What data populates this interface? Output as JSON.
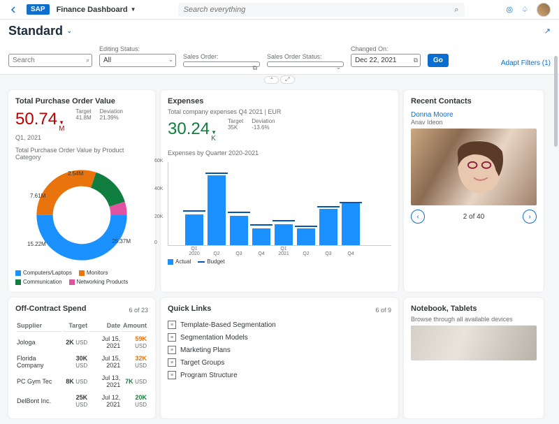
{
  "topbar": {
    "app_title": "Finance Dashboard",
    "search_placeholder": "Search everything"
  },
  "header": {
    "page_title": "Standard"
  },
  "filters": {
    "search_placeholder": "Search",
    "editing_label": "Editing Status:",
    "editing_value": "All",
    "sales_order_label": "Sales Order:",
    "sales_status_label": "Sales Order Status:",
    "changed_label": "Changed On:",
    "changed_value": "Dec 22, 2021",
    "go": "Go",
    "adapt": "Adapt Filters (1)"
  },
  "purchase_card": {
    "title": "Total Purchase Order Value",
    "value": "50.74",
    "unit": "M",
    "period": "Q1, 2021",
    "target_label": "Target",
    "target": "41.8M",
    "deviation_label": "Deviation",
    "deviation": "21.39%",
    "chart_title": "Total Purchase Order Value by Product Category",
    "legend": [
      "Computers/Laptops",
      "Monitors",
      "Communication",
      "Networking Products"
    ]
  },
  "expenses_card": {
    "title": "Expenses",
    "subtitle": "Total company expenses Q4 2021 | EUR",
    "value": "30.24",
    "unit": "K",
    "target_label": "Target",
    "target": "35K",
    "deviation_label": "Deviation",
    "deviation": "-13.6%",
    "chart_title": "Expenses by Quarter 2020-2021",
    "legend_actual": "Actual",
    "legend_budget": "Budget"
  },
  "contacts": {
    "title": "Recent Contacts",
    "name1": "Donna Moore",
    "name2": "Anav Ideon",
    "pager": "2 of 40"
  },
  "spend": {
    "title": "Off-Contract Spend",
    "pager": "6 of 23",
    "cols": {
      "supplier": "Supplier",
      "target": "Target",
      "date": "Date",
      "amount": "Amount"
    },
    "rows": [
      {
        "supplier": "Jologa",
        "target": "2K",
        "date": "Jul 15, 2021",
        "amount": "59K"
      },
      {
        "supplier": "Florida Company",
        "target": "30K",
        "date": "Jul 15, 2021",
        "amount": "32K"
      },
      {
        "supplier": "PC Gym Tec",
        "target": "8K",
        "date": "Jul 13, 2021",
        "amount": "7K"
      },
      {
        "supplier": "DelBont Inc.",
        "target": "25K",
        "date": "Jul 12, 2021",
        "amount": "20K"
      }
    ],
    "usd": "USD"
  },
  "quicklinks": {
    "title": "Quick Links",
    "pager": "6 of 9",
    "items": [
      "Template-Based Segmentation",
      "Segmentation Models",
      "Marketing Plans",
      "Target Groups",
      "Program Structure"
    ]
  },
  "notebook": {
    "title": "Notebook, Tablets",
    "subtitle": "Browse through all available devices"
  },
  "chart_data": [
    {
      "type": "pie",
      "title": "Total Purchase Order Value by Product Category",
      "series": [
        {
          "name": "Computers/Laptops",
          "value": 25.37,
          "color": "#1b90ff"
        },
        {
          "name": "Monitors",
          "value": 15.22,
          "color": "#e9730c"
        },
        {
          "name": "Communication",
          "value": 7.61,
          "color": "#107e3e"
        },
        {
          "name": "Networking Products",
          "value": 2.54,
          "color": "#e252a3"
        }
      ],
      "unit": "M"
    },
    {
      "type": "bar",
      "title": "Expenses by Quarter 2020-2021",
      "categories": [
        "Q1 2020",
        "Q2",
        "Q3",
        "Q4",
        "Q1 2021",
        "Q2",
        "Q3",
        "Q4"
      ],
      "series": [
        {
          "name": "Actual",
          "values": [
            22000,
            50000,
            21000,
            12000,
            15000,
            12000,
            26000,
            30000
          ]
        },
        {
          "name": "Budget",
          "values": [
            25000,
            52000,
            24000,
            15000,
            18000,
            14000,
            28000,
            31000
          ]
        }
      ],
      "ylabel": "",
      "ylim": [
        0,
        60000
      ],
      "yticks": [
        0,
        20000,
        40000,
        60000
      ]
    }
  ]
}
